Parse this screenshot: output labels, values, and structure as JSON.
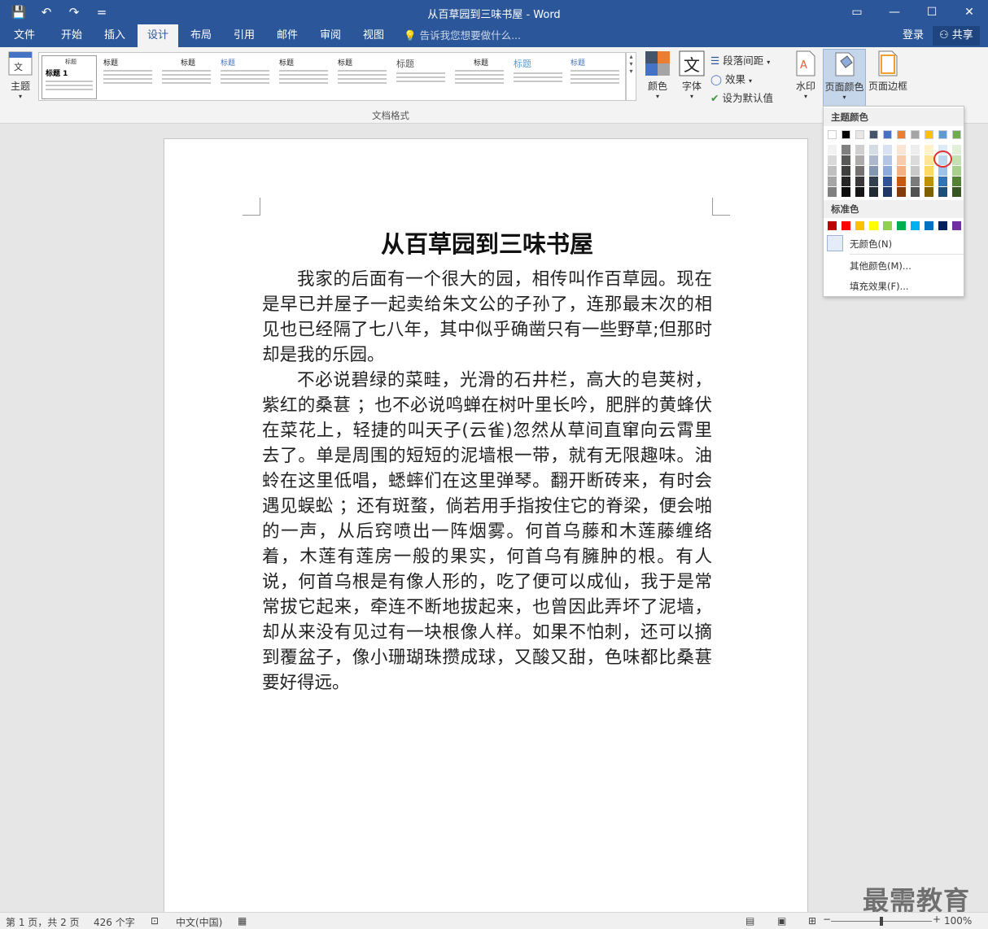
{
  "window": {
    "title": "从百草园到三味书屋 - Word",
    "qat_save": "💾",
    "qat_undo": "↶",
    "qat_redo": "↷",
    "qat_more": "=",
    "ctl_ribbon": "▭",
    "ctl_min": "—",
    "ctl_max": "☐",
    "ctl_close": "✕"
  },
  "tabs": [
    {
      "label": "文件",
      "active": false
    },
    {
      "label": "开始",
      "active": false
    },
    {
      "label": "插入",
      "active": false
    },
    {
      "label": "设计",
      "active": true
    },
    {
      "label": "布局",
      "active": false
    },
    {
      "label": "引用",
      "active": false
    },
    {
      "label": "邮件",
      "active": false
    },
    {
      "label": "审阅",
      "active": false
    },
    {
      "label": "视图",
      "active": false
    }
  ],
  "tellme": "告诉我您想要做什么...",
  "login": "登录",
  "share": "共享",
  "ribbon": {
    "theme_label": "主题",
    "gallery_items": [
      "标题 1",
      "标题",
      "标题",
      "标题",
      "标题",
      "标题",
      "标题",
      "标题",
      "标题",
      "标题"
    ],
    "group_label": "文档格式",
    "colors_label": "颜色",
    "fonts_label": "字体",
    "paragraph_spacing": "段落间距",
    "effects": "效果",
    "set_default": "设为默认值",
    "watermark_label": "水印",
    "page_color_label": "页面颜色",
    "page_border_label": "页面边框"
  },
  "document": {
    "title": "从百草园到三味书屋",
    "paragraphs": [
      "我家的后面有一个很大的园，相传叫作百草园。现在是早已并屋子一起卖给朱文公的子孙了，连那最末次的相见也已经隔了七八年，其中似乎确凿只有一些野草;但那时却是我的乐园。",
      "不必说碧绿的菜畦，光滑的石井栏，高大的皂荚树，紫红的桑葚 ；也不必说鸣蝉在树叶里长吟，肥胖的黄蜂伏在菜花上，轻捷的叫天子(云雀)忽然从草间直窜向云霄里去了。单是周围的短短的泥墙根一带，就有无限趣味。油蛉在这里低唱，蟋蟀们在这里弹琴。翻开断砖来，有时会遇见蜈蚣 ；还有斑蝥，倘若用手指按住它的脊梁，便会啪的一声，从后窍喷出一阵烟雾。何首乌藤和木莲藤缠络着，木莲有莲房一般的果实，何首乌有臃肿的根。有人说，何首乌根是有像人形的，吃了便可以成仙，我于是常常拔它起来，牵连不断地拔起来，也曾因此弄坏了泥墙，却从来没有见过有一块根像人样。如果不怕刺，还可以摘到覆盆子，像小珊瑚珠攒成球，又酸又甜，色味都比桑葚要好得远。"
    ]
  },
  "dropdown": {
    "theme_colors_label": "主题颜色",
    "standard_colors_label": "标准色",
    "no_color": "无颜色(N)",
    "more_colors": "其他颜色(M)...",
    "fill_effects": "填充效果(F)...",
    "theme_top": [
      "#ffffff",
      "#000000",
      "#e7e6e6",
      "#44546a",
      "#4472c4",
      "#ed7d31",
      "#a5a5a5",
      "#ffc000",
      "#5b9bd5",
      "#70ad47"
    ],
    "theme_shades": [
      [
        "#f2f2f2",
        "#d9d9d9",
        "#bfbfbf",
        "#a6a6a6",
        "#808080"
      ],
      [
        "#7f7f7f",
        "#595959",
        "#3f3f3f",
        "#262626",
        "#0d0d0d"
      ],
      [
        "#d0cece",
        "#aeaaaa",
        "#757171",
        "#3a3838",
        "#171616"
      ],
      [
        "#d6dce4",
        "#adb9ca",
        "#8496b0",
        "#323f4f",
        "#222a35"
      ],
      [
        "#d9e2f3",
        "#b4c6e7",
        "#8eaadb",
        "#2f5496",
        "#1f3864"
      ],
      [
        "#fbe5d5",
        "#f7cbac",
        "#f4b183",
        "#c55a11",
        "#833c0b"
      ],
      [
        "#ededed",
        "#dbdbdb",
        "#c9c9c9",
        "#7b7b7b",
        "#525252"
      ],
      [
        "#fff2cc",
        "#ffe599",
        "#ffd965",
        "#bf9000",
        "#7f6000"
      ],
      [
        "#deebf6",
        "#bdd7ee",
        "#9cc3e5",
        "#2e75b5",
        "#1f4e79"
      ],
      [
        "#e2efd9",
        "#c5e0b3",
        "#a8d08d",
        "#538135",
        "#375623"
      ]
    ],
    "standard": [
      "#c00000",
      "#ff0000",
      "#ffc000",
      "#ffff00",
      "#92d050",
      "#00b050",
      "#00b0f0",
      "#0070c0",
      "#002060",
      "#7030a0"
    ]
  },
  "status": {
    "page": "第 1 页，共 2 页",
    "words": "426 个字",
    "language": "中文(中国)",
    "zoom": "100%",
    "zoom_minus": "−",
    "zoom_plus": "+"
  },
  "watermark_text": "最需教育"
}
